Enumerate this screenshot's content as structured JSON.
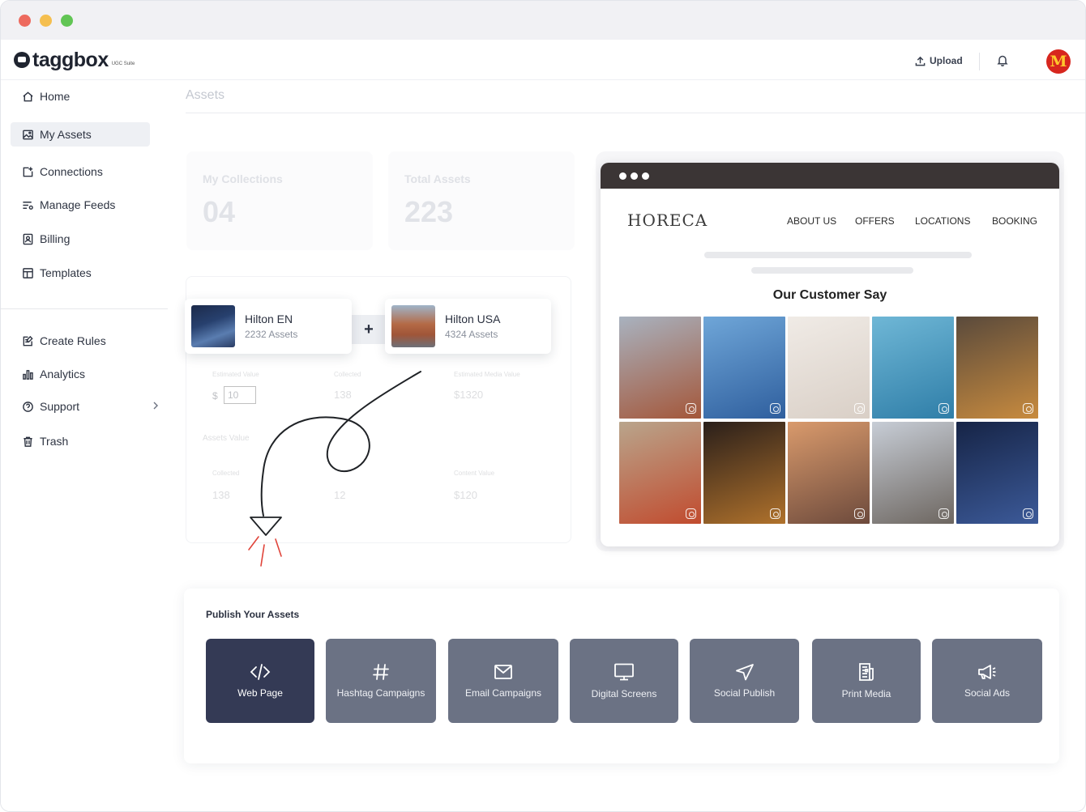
{
  "window": {
    "controls": [
      "close",
      "minimize",
      "maximize"
    ]
  },
  "brand": {
    "name": "taggbox",
    "suite": "UGC Suite"
  },
  "topbar": {
    "upload_label": "Upload",
    "avatar_icon": "mcdonalds-logo",
    "avatar_glyph": "M"
  },
  "sidebar": {
    "items": [
      {
        "label": "Home",
        "icon": "home-icon"
      },
      {
        "label": "My Assets",
        "icon": "image-icon",
        "active": true
      },
      {
        "label": "Connections",
        "icon": "connections-icon"
      },
      {
        "label": "Manage Feeds",
        "icon": "feeds-icon"
      },
      {
        "label": "Billing",
        "icon": "billing-icon"
      },
      {
        "label": "Templates",
        "icon": "templates-icon"
      },
      {
        "label": "Create Rules",
        "icon": "rules-icon"
      },
      {
        "label": "Analytics",
        "icon": "analytics-icon"
      },
      {
        "label": "Support",
        "icon": "support-icon"
      },
      {
        "label": "Trash",
        "icon": "trash-icon"
      }
    ]
  },
  "background": {
    "page_title": "Assets",
    "stats": [
      {
        "label": "My Collections",
        "value": "04"
      },
      {
        "label": "Total Assets",
        "value": "223"
      }
    ],
    "panel": {
      "row1": [
        {
          "label": "Estimated Value",
          "prefix": "$",
          "value": "10"
        },
        {
          "label": "Collected",
          "value": "138"
        },
        {
          "label": "Estimated Media Value",
          "value": "$1320"
        }
      ],
      "section": "Assets Value",
      "row2": [
        {
          "label": "Collected",
          "value": "138"
        },
        {
          "value": "12"
        },
        {
          "label": "Content Value",
          "value": "$120"
        }
      ]
    }
  },
  "collections": [
    {
      "name": "Hilton EN",
      "count": "2232 Assets"
    },
    {
      "name": "Hilton USA",
      "count": "4324 Assets"
    }
  ],
  "preview": {
    "brand": "HORECA",
    "nav": [
      "ABOUT US",
      "OFFERS",
      "LOCATIONS",
      "BOOKING"
    ],
    "heading": "Our Customer Say",
    "photos": [
      {
        "subject": "hotel-building",
        "colors": [
          "#a8b2bf",
          "#a4573a"
        ]
      },
      {
        "subject": "coffee-cup-beach",
        "colors": [
          "#6fa6d8",
          "#2f5f9e"
        ]
      },
      {
        "subject": "woman-in-bed",
        "colors": [
          "#f0ebe6",
          "#d9cfc6"
        ]
      },
      {
        "subject": "pool-palms",
        "colors": [
          "#6fb7d6",
          "#2f7ea8"
        ]
      },
      {
        "subject": "burger-fries",
        "colors": [
          "#5a4a3c",
          "#c88b3e"
        ]
      },
      {
        "subject": "food-spread",
        "colors": [
          "#b9a58c",
          "#c14b2e"
        ]
      },
      {
        "subject": "burger-closeup",
        "colors": [
          "#2a1f1a",
          "#b0722c"
        ]
      },
      {
        "subject": "woman-city-view",
        "colors": [
          "#d99a6c",
          "#6d4a3c"
        ]
      },
      {
        "subject": "dog-chewy-box",
        "colors": [
          "#c7cdd6",
          "#6d6660"
        ]
      },
      {
        "subject": "hotel-night",
        "colors": [
          "#162446",
          "#3c5a99"
        ]
      }
    ]
  },
  "publish": {
    "title": "Publish Your Assets",
    "tiles": [
      {
        "label": "Web Page",
        "icon": "code-icon",
        "active": true
      },
      {
        "label": "Hashtag Campaigns",
        "icon": "hashtag-icon"
      },
      {
        "label": "Email Campaigns",
        "icon": "mail-icon"
      },
      {
        "label": "Digital Screens",
        "icon": "monitor-icon"
      },
      {
        "label": "Social Publish",
        "icon": "send-icon"
      },
      {
        "label": "Print Media",
        "icon": "newspaper-icon"
      },
      {
        "label": "Social Ads",
        "icon": "megaphone-icon"
      }
    ]
  }
}
